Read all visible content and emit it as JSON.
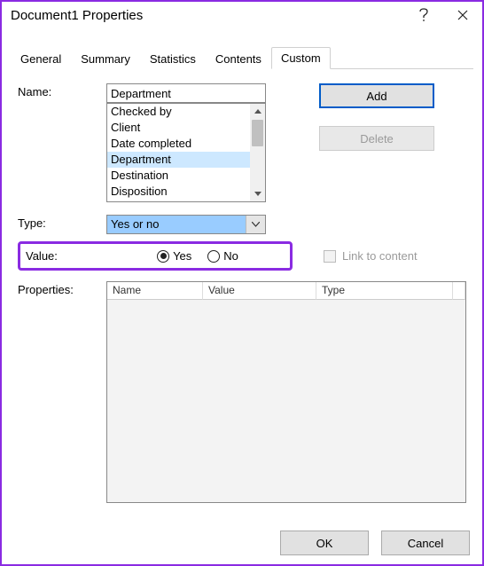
{
  "window": {
    "title": "Document1 Properties"
  },
  "tabs": {
    "items": [
      {
        "label": "General"
      },
      {
        "label": "Summary"
      },
      {
        "label": "Statistics"
      },
      {
        "label": "Contents"
      },
      {
        "label": "Custom"
      }
    ],
    "activeIndex": 4
  },
  "labels": {
    "name": "Name:",
    "type": "Type:",
    "value": "Value:",
    "properties": "Properties:",
    "linkToContent": "Link to content"
  },
  "name": {
    "value": "Department",
    "options": [
      "Checked by",
      "Client",
      "Date completed",
      "Department",
      "Destination",
      "Disposition"
    ],
    "selectedIndex": 3
  },
  "type": {
    "value": "Yes or no"
  },
  "valueRadios": {
    "yes": "Yes",
    "no": "No",
    "selected": "yes"
  },
  "buttons": {
    "add": "Add",
    "delete": "Delete",
    "ok": "OK",
    "cancel": "Cancel"
  },
  "grid": {
    "columns": {
      "name": "Name",
      "value": "Value",
      "type": "Type"
    },
    "rows": []
  }
}
